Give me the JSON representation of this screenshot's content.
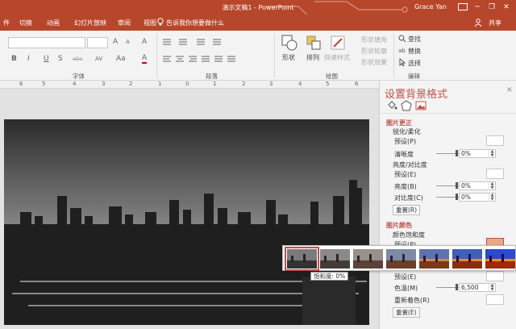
{
  "window": {
    "title": "演示文稿1 - PowerPoint",
    "user": "Grace Yan",
    "min_glyph": "─",
    "restore_glyph": "❐",
    "close_glyph": "✕"
  },
  "tabs": [
    "件",
    "切换",
    "动画",
    "幻灯片放映",
    "审阅",
    "视图"
  ],
  "tell_me": "告诉我你想要做什么",
  "share": "共享",
  "ribbon": {
    "font_group": "字体",
    "para_group": "段落",
    "draw_group": "绘图",
    "edit_group": "编辑",
    "shapes": "形状",
    "arrange": "排列",
    "quick_styles": "快速样式",
    "shape_fill": "形状填充",
    "shape_outline": "形状轮廓",
    "shape_effects": "形状效果",
    "find": "查找",
    "replace": "替换",
    "select": "选择",
    "bold": "B",
    "italic": "I",
    "underline": "U",
    "strike": "S",
    "abc": "abc",
    "av": "AV",
    "aa": "Aa",
    "grow": "A",
    "shrink": "A",
    "clear": "A",
    "fontcolor": "A"
  },
  "ruler": [
    "6",
    "5",
    "4",
    "3",
    "2",
    "1",
    "0",
    "1",
    "2",
    "3",
    "4",
    "5",
    "6"
  ],
  "pane": {
    "title": "设置背景格式",
    "close": "×",
    "corrections_title": "图片更正",
    "sharpen_title": "锐化/柔化",
    "preset1": "预设(P)",
    "clarity": "清晰度",
    "clarity_val": "0%",
    "bc_title": "亮度/对比度",
    "preset2": "预设(E)",
    "brightness": "亮度(B)",
    "brightness_val": "0%",
    "contrast": "对比度(C)",
    "contrast_val": "0%",
    "reset1": "重置(R)",
    "color_title": "图片颜色",
    "sat_title": "颜色饱和度",
    "preset3": "预设(P)",
    "preset4": "预设(E)",
    "temp": "色温(M)",
    "temp_val": "6,500",
    "recolor": "重新着色(R)",
    "reset2": "重置(E)"
  },
  "tooltip": "饱和度: 0%",
  "colors": {
    "accent": "#b7472a",
    "pane_title": "#c0504d"
  }
}
